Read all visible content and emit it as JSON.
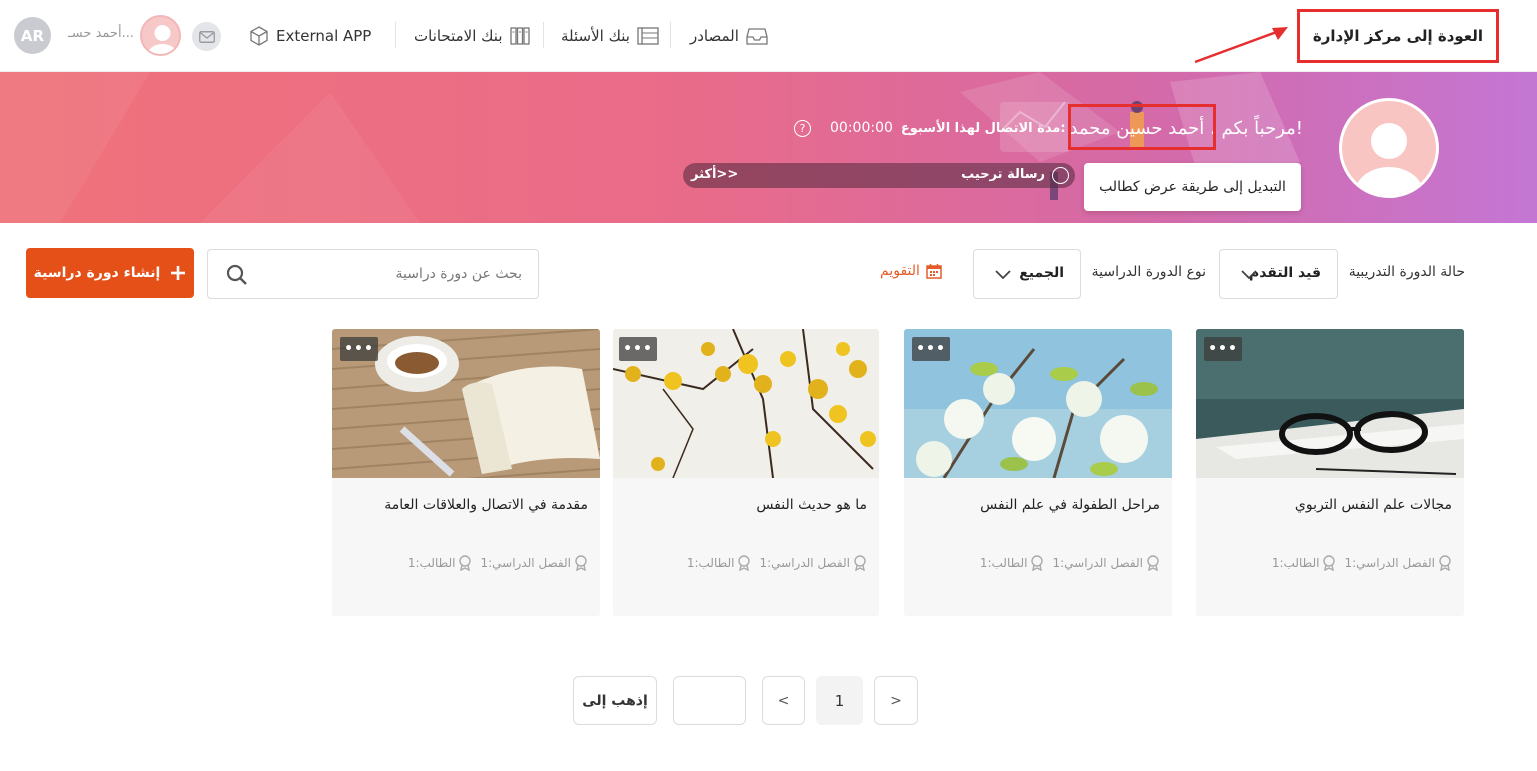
{
  "header": {
    "user_initials": "AR",
    "user_name": "أحمد حسـ...",
    "nav": [
      {
        "label": "External APP",
        "icon": "cube-icon"
      },
      {
        "label": "بنك الامتحانات",
        "icon": "exam-bank-icon"
      },
      {
        "label": "بنك الأسئلة",
        "icon": "question-bank-icon"
      },
      {
        "label": "المصادر",
        "icon": "inbox-icon"
      }
    ],
    "admin_button": "العودة إلى مركز الإدارة"
  },
  "banner": {
    "welcome": "مرحباً بكم ، أحمد حسين محمد!",
    "duration_label": "مدة الاتصال لهذا الأسبوع:",
    "duration_value": "00:00:00",
    "message_label": "رسالة ترحيب",
    "more_label": "أكثر>>",
    "tooltip": "التبديل إلى طريقة عرض كطالب"
  },
  "filters": {
    "status_label": "حالة الدورة التدريبية",
    "status_value": "قيد التقدم",
    "type_label": "نوع الدورة الدراسية",
    "type_value": "الجميع",
    "calendar_label": "التقويم",
    "search_placeholder": "بحث عن دورة دراسية",
    "create_label": "إنشاء دورة دراسية"
  },
  "courses": [
    {
      "title": "مجالات علم النفس التربوي",
      "class_label": "الفصل الدراسي:1",
      "student_label": "الطالب:1",
      "more": "•••"
    },
    {
      "title": "مراحل الطفولة في علم النفس",
      "class_label": "الفصل الدراسي:1",
      "student_label": "الطالب:1",
      "more": "•••"
    },
    {
      "title": "ما هو حديث النفس",
      "class_label": "الفصل الدراسي:1",
      "student_label": "الطالب:1",
      "more": "•••"
    },
    {
      "title": "مقدمة في الاتصال والعلاقات العامة",
      "class_label": "الفصل الدراسي:1",
      "student_label": "الطالب:1",
      "more": "•••"
    }
  ],
  "pager": {
    "next": ">",
    "current": "1",
    "prev": "<",
    "goto_value": "",
    "goto_label": "إذهب إلى"
  },
  "colors": {
    "accent": "#e54f18",
    "highlight_box": "#e62e2e",
    "banner_start": "#f0727a",
    "banner_end": "#c476d4"
  }
}
